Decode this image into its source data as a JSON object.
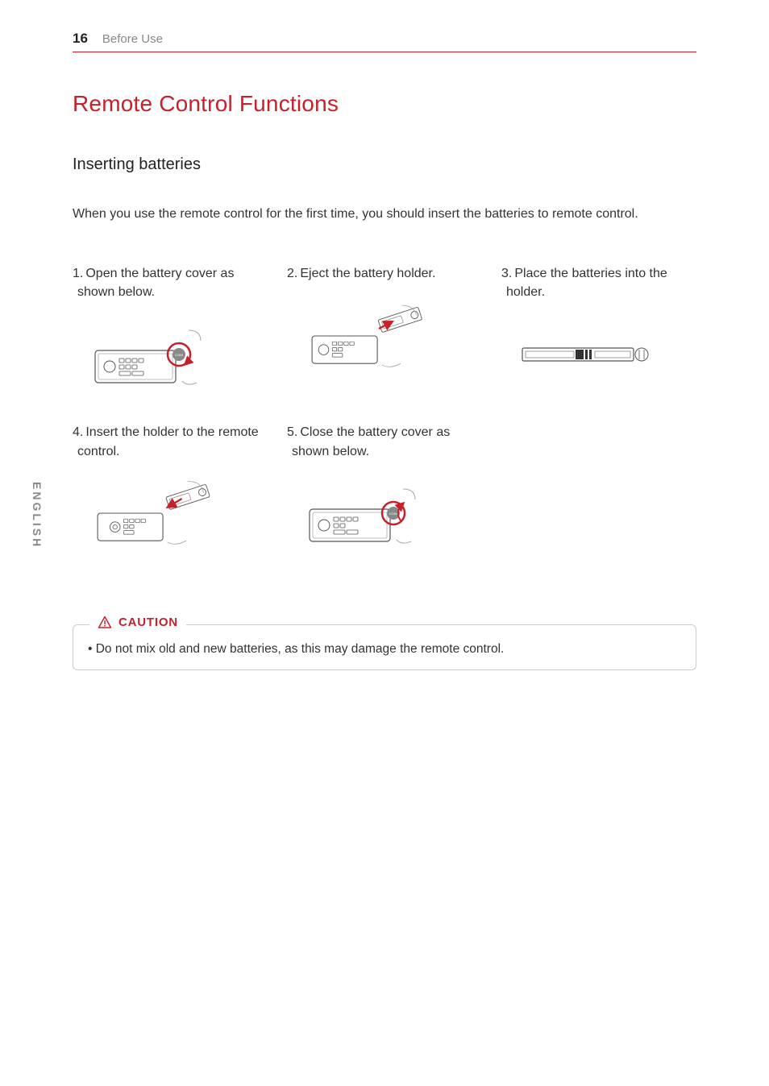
{
  "header": {
    "page_number": "16",
    "section": "Before Use"
  },
  "title": "Remote Control Functions",
  "subtitle": "Inserting batteries",
  "intro": "When you use the remote control for the first time, you should insert the batteries to remote control.",
  "steps": [
    {
      "num": "1.",
      "text": "Open the battery cover as shown below."
    },
    {
      "num": "2.",
      "text": "Eject the battery holder."
    },
    {
      "num": "3.",
      "text": "Place the batteries into the holder."
    },
    {
      "num": "4.",
      "text": "Insert the holder to the remote control."
    },
    {
      "num": "5.",
      "text": "Close the battery cover as shown below."
    }
  ],
  "caution": {
    "label": "CAUTION",
    "text": "Do not mix old and new batteries, as this may damage the remote control."
  },
  "side_tab": "ENGLISH",
  "figure_labels": {
    "coin": "COIN"
  }
}
